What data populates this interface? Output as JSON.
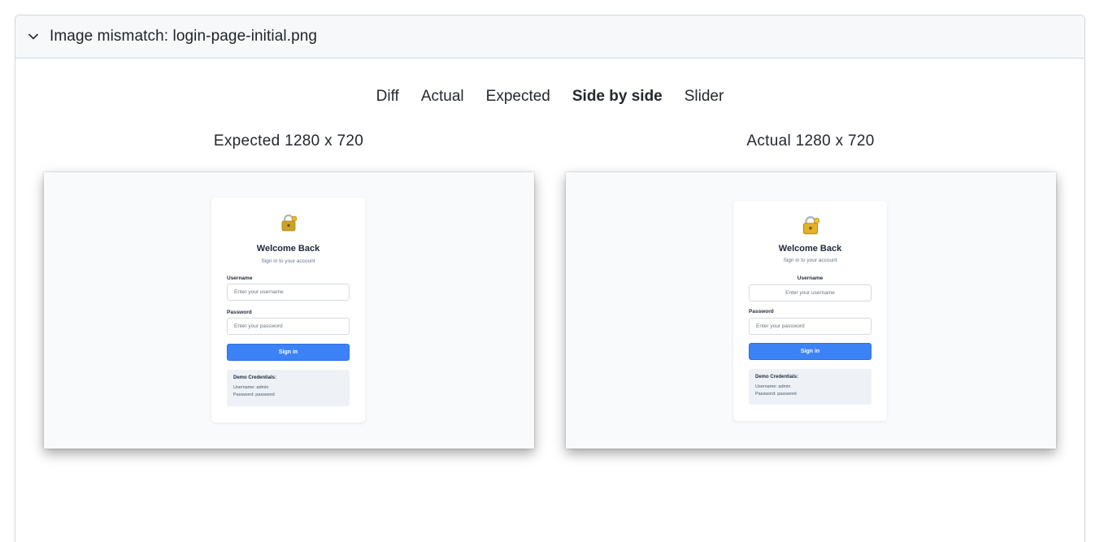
{
  "panel": {
    "title": "Image mismatch: login-page-initial.png"
  },
  "tabs": [
    {
      "label": "Diff",
      "active": false
    },
    {
      "label": "Actual",
      "active": false
    },
    {
      "label": "Expected",
      "active": false
    },
    {
      "label": "Side by side",
      "active": true
    },
    {
      "label": "Slider",
      "active": false
    }
  ],
  "expected": {
    "caption": "Expected 1280 x 720",
    "card": {
      "title": "Welcome Back",
      "subtitle": "Sign in to your account",
      "username_label": "Username",
      "username_placeholder": "Enter your username",
      "password_label": "Password",
      "password_placeholder": "Enter your password",
      "button": "Sign in",
      "demo_title": "Demo Credentials:",
      "demo_user": "Username: admin",
      "demo_pass": "Password: password"
    }
  },
  "actual": {
    "caption": "Actual 1280 x 720",
    "card": {
      "title": "Welcome Back",
      "subtitle": "Sign in to your account",
      "username_label": "Username",
      "username_placeholder": "Enter your username",
      "password_label": "Password",
      "password_placeholder": "Enter your password",
      "button": "Sign in",
      "demo_title": "Demo Credentials:",
      "demo_user": "Username: admin",
      "demo_pass": "Password: password"
    }
  },
  "colors": {
    "accent": "#3b82f6",
    "header_bg": "#f6f8fa",
    "border": "#d0d7de"
  },
  "icons": {
    "collapse": "chevron-down-icon",
    "lock": "lock-icon"
  }
}
